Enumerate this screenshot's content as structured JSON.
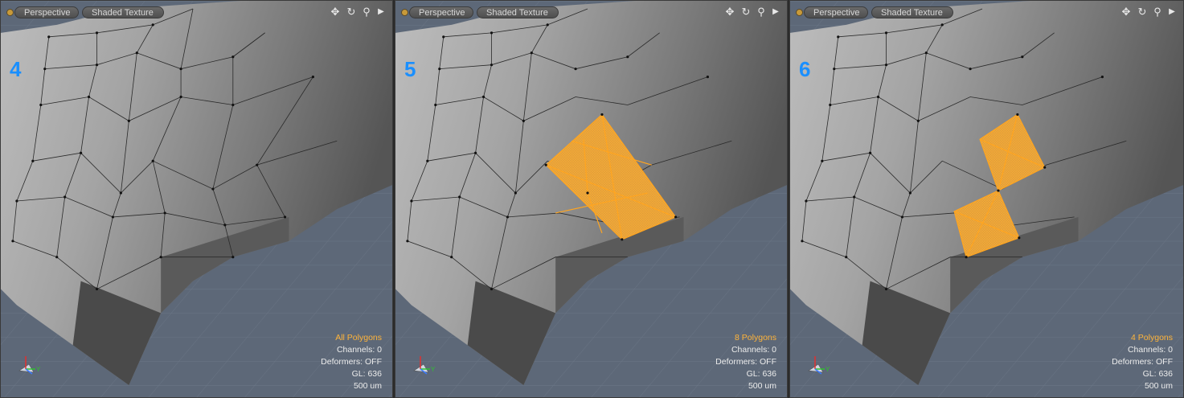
{
  "viewports": [
    {
      "number": "4",
      "view_label": "Perspective",
      "shading_label": "Shaded Texture",
      "selection": "All Polygons",
      "channels": "Channels: 0",
      "deformers": "Deformers: OFF",
      "gl": "GL: 636",
      "scale": "500 um"
    },
    {
      "number": "5",
      "view_label": "Perspective",
      "shading_label": "Shaded Texture",
      "selection": "8 Polygons",
      "channels": "Channels: 0",
      "deformers": "Deformers: OFF",
      "gl": "GL: 636",
      "scale": "500 um"
    },
    {
      "number": "6",
      "view_label": "Perspective",
      "shading_label": "Shaded Texture",
      "selection": "4 Polygons",
      "channels": "Channels: 0",
      "deformers": "Deformers: OFF",
      "gl": "GL: 636",
      "scale": "500 um"
    }
  ],
  "axis_labels": {
    "y": "Y"
  },
  "icons": {
    "move": "move-view-icon",
    "rotate": "rotate-view-icon",
    "zoom": "zoom-view-icon",
    "more": "more-options-icon",
    "menu": "viewport-menu-icon"
  },
  "colors": {
    "background": "#5d6878",
    "selection": "#ffa520",
    "selection_text": "#ffb43a",
    "viewport_number": "#1a8fff"
  }
}
